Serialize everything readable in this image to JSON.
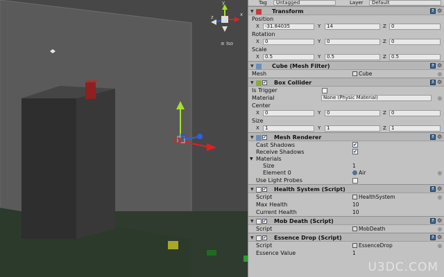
{
  "scene": {
    "iso_label": "Iso",
    "axis_y": "y",
    "axis_x": "x",
    "axis_z": "z"
  },
  "header": {
    "tag_label": "Tag",
    "tag_value": "Untagged",
    "layer_label": "Layer",
    "layer_value": "Default"
  },
  "transform": {
    "title": "Transform",
    "position_label": "Position",
    "position": {
      "x": "-31.84035",
      "y": "14",
      "z": "0"
    },
    "rotation_label": "Rotation",
    "rotation": {
      "x": "0",
      "y": "0",
      "z": "0"
    },
    "scale_label": "Scale",
    "scale": {
      "x": "0.5",
      "y": "0.5",
      "z": "0.5"
    },
    "axis_labels": {
      "x": "X",
      "y": "Y",
      "z": "Z"
    }
  },
  "mesh_filter": {
    "title": "Cube (Mesh Filter)",
    "mesh_label": "Mesh",
    "mesh_value": "Cube"
  },
  "box_collider": {
    "title": "Box Collider",
    "is_trigger_label": "Is Trigger",
    "material_label": "Material",
    "material_value": "None (Physic Material)",
    "center_label": "Center",
    "center": {
      "x": "0",
      "y": "0",
      "z": "0"
    },
    "size_label": "Size",
    "size": {
      "x": "1",
      "y": "1",
      "z": "1"
    }
  },
  "mesh_renderer": {
    "title": "Mesh Renderer",
    "cast_shadows_label": "Cast Shadows",
    "receive_shadows_label": "Receive Shadows",
    "materials_label": "Materials",
    "size_label": "Size",
    "size_value": "1",
    "element0_label": "Element 0",
    "element0_value": "Air",
    "light_probes_label": "Use Light Probes"
  },
  "health_system": {
    "title": "Health System (Script)",
    "script_label": "Script",
    "script_value": "HealthSystem",
    "max_health_label": "Max Health",
    "max_health_value": "10",
    "current_health_label": "Current Health",
    "current_health_value": "10"
  },
  "mob_death": {
    "title": "Mob Death (Script)",
    "script_label": "Script",
    "script_value": "MobDeath"
  },
  "essence_drop": {
    "title": "Essence Drop (Script)",
    "script_label": "Script",
    "script_value": "EssenceDrop",
    "essence_value_label": "Essence Value",
    "essence_value_value": "1"
  },
  "watermark": "U3DC.COM",
  "colors": {
    "inspector_bg": "#c2c2c2",
    "scene_bg": "#474747",
    "checkbox_check": "#1a3a8a"
  }
}
